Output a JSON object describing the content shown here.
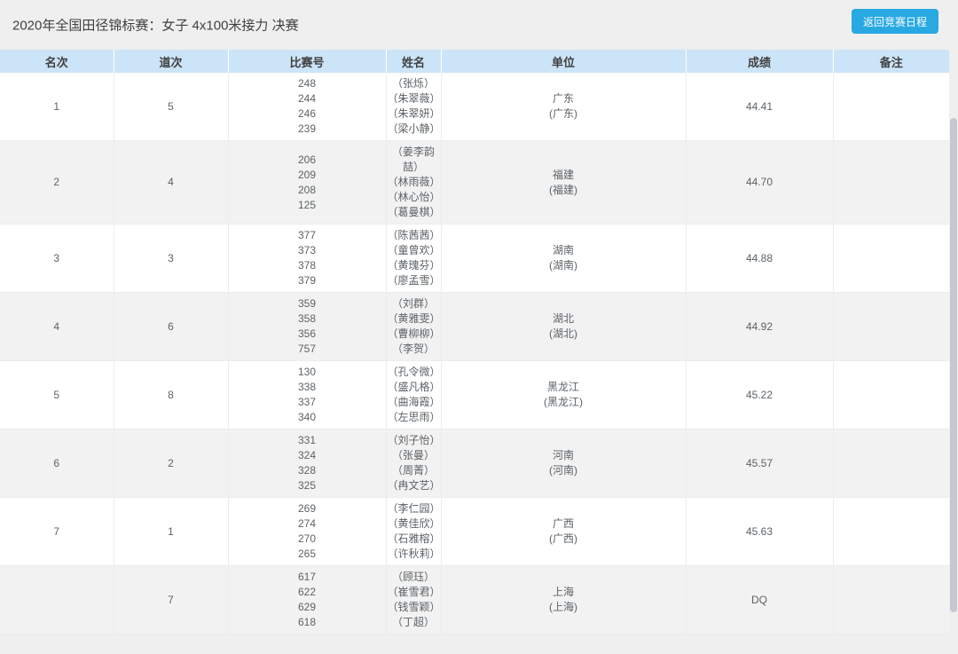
{
  "header": {
    "title": "2020年全国田径锦标赛：女子 4x100米接力 决赛",
    "back_button_label": "返回竞赛日程"
  },
  "table": {
    "columns": [
      "名次",
      "道次",
      "比赛号",
      "姓名",
      "单位",
      "成绩",
      "备注"
    ],
    "rows": [
      {
        "rank": "1",
        "lane": "5",
        "bibs": [
          "248",
          "244",
          "246",
          "239"
        ],
        "names": [
          "（张烁）",
          "（朱翠薇）",
          "（朱翠妍）",
          "（梁小静）"
        ],
        "unit": [
          "广东",
          "(广东)"
        ],
        "result": "44.41",
        "remark": ""
      },
      {
        "rank": "2",
        "lane": "4",
        "bibs": [
          "206",
          "209",
          "208",
          "125"
        ],
        "names": [
          "（姜李韵喆）",
          "（林雨薇）",
          "（林心怡）",
          "（葛曼棋）"
        ],
        "unit": [
          "福建",
          "(福建)"
        ],
        "result": "44.70",
        "remark": ""
      },
      {
        "rank": "3",
        "lane": "3",
        "bibs": [
          "377",
          "373",
          "378",
          "379"
        ],
        "names": [
          "（陈茜茜）",
          "（童曾欢）",
          "（黄瑰芬）",
          "（廖孟雪）"
        ],
        "unit": [
          "湖南",
          "(湖南)"
        ],
        "result": "44.88",
        "remark": ""
      },
      {
        "rank": "4",
        "lane": "6",
        "bibs": [
          "359",
          "358",
          "356",
          "757"
        ],
        "names": [
          "（刘群）",
          "（黄雅雯）",
          "（曹柳柳）",
          "（李贺）"
        ],
        "unit": [
          "湖北",
          "(湖北)"
        ],
        "result": "44.92",
        "remark": ""
      },
      {
        "rank": "5",
        "lane": "8",
        "bibs": [
          "130",
          "338",
          "337",
          "340"
        ],
        "names": [
          "（孔令微）",
          "（盛凡格）",
          "（曲海霞）",
          "（左思雨）"
        ],
        "unit": [
          "黑龙江",
          "(黑龙江)"
        ],
        "result": "45.22",
        "remark": ""
      },
      {
        "rank": "6",
        "lane": "2",
        "bibs": [
          "331",
          "324",
          "328",
          "325"
        ],
        "names": [
          "（刘子怡）",
          "（张曼）",
          "（周菁）",
          "（冉文艺）"
        ],
        "unit": [
          "河南",
          "(河南)"
        ],
        "result": "45.57",
        "remark": ""
      },
      {
        "rank": "7",
        "lane": "1",
        "bibs": [
          "269",
          "274",
          "270",
          "265"
        ],
        "names": [
          "（李仁园）",
          "（黄佳欣）",
          "（石雅榕）",
          "（许秋莉）"
        ],
        "unit": [
          "广西",
          "(广西)"
        ],
        "result": "45.63",
        "remark": ""
      },
      {
        "rank": "",
        "lane": "7",
        "bibs": [
          "617",
          "622",
          "629",
          "618"
        ],
        "names": [
          "（顾珏）",
          "（崔雪君）",
          "（钱雪颖）",
          "（丁超）"
        ],
        "unit": [
          "上海",
          "(上海)"
        ],
        "result": "DQ",
        "remark": ""
      }
    ]
  },
  "colors": {
    "accent_button": "#29a9e2",
    "table_header_bg": "#cce4f8",
    "alt_row_bg": "#f2f2f2",
    "page_bg": "#efefef"
  }
}
